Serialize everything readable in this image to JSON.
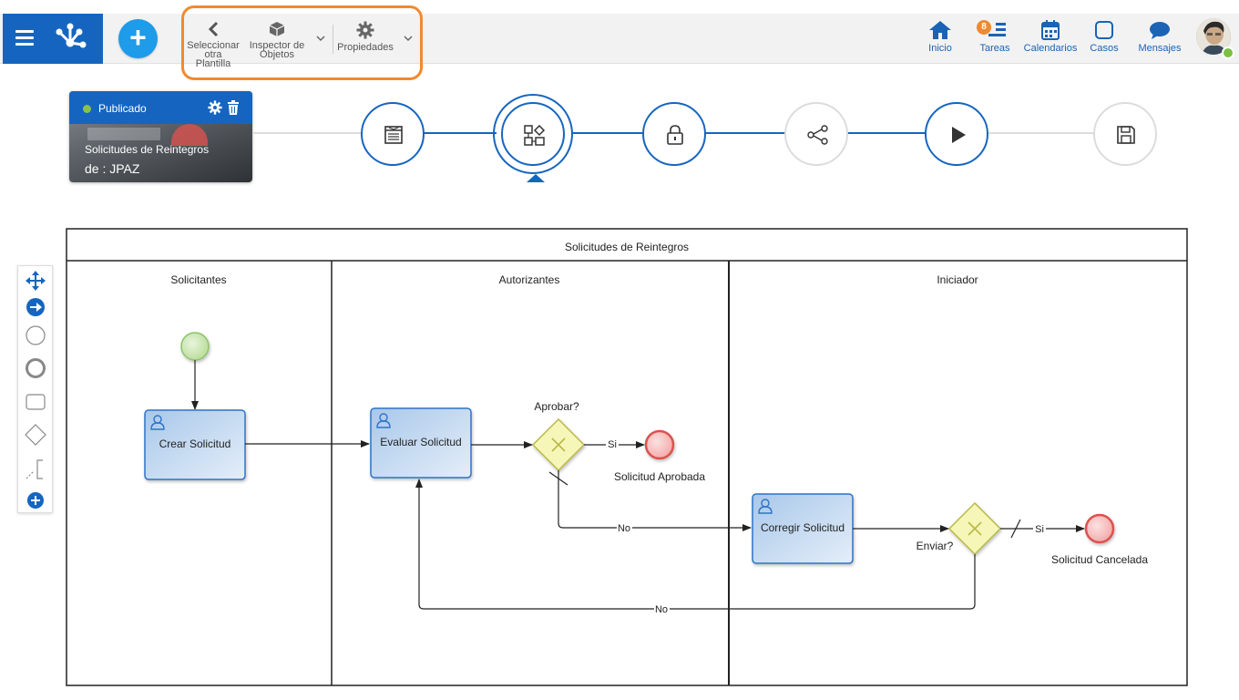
{
  "toolbar": {
    "select_template_line1": "Seleccionar",
    "select_template_line2": "otra Plantilla",
    "object_inspector_line1": "Inspector de",
    "object_inspector_line2": "Objetos",
    "properties": "Propiedades"
  },
  "nav": {
    "home": "Inicio",
    "tasks": "Tareas",
    "tasks_count": "8",
    "calendars": "Calendarios",
    "cases": "Casos",
    "messages": "Mensajes"
  },
  "card": {
    "status": "Publicado",
    "title": "Solicitudes de Reintegros",
    "subtitle": "de : JPAZ"
  },
  "colors": {
    "primary": "#1565c0",
    "accent_orange": "#f08a30",
    "add_button": "#1e9be9",
    "status_green": "#8bc34a"
  },
  "diagram": {
    "pool_title": "Solicitudes de Reintegros",
    "lanes": [
      "Solicitantes",
      "Autorizantes",
      "Iniciador"
    ],
    "tasks": {
      "create": "Crear Solicitud",
      "evaluate": "Evaluar Solicitud",
      "correct": "Corregir Solicitud"
    },
    "gateways": {
      "approve": "Aprobar?",
      "send": "Enviar?"
    },
    "events": {
      "approved": "Solicitud Aprobada",
      "cancelled": "Solicitud Cancelada"
    },
    "flows": {
      "yes1": "Si",
      "no1": "No",
      "yes2": "Si",
      "no2": "No"
    }
  }
}
